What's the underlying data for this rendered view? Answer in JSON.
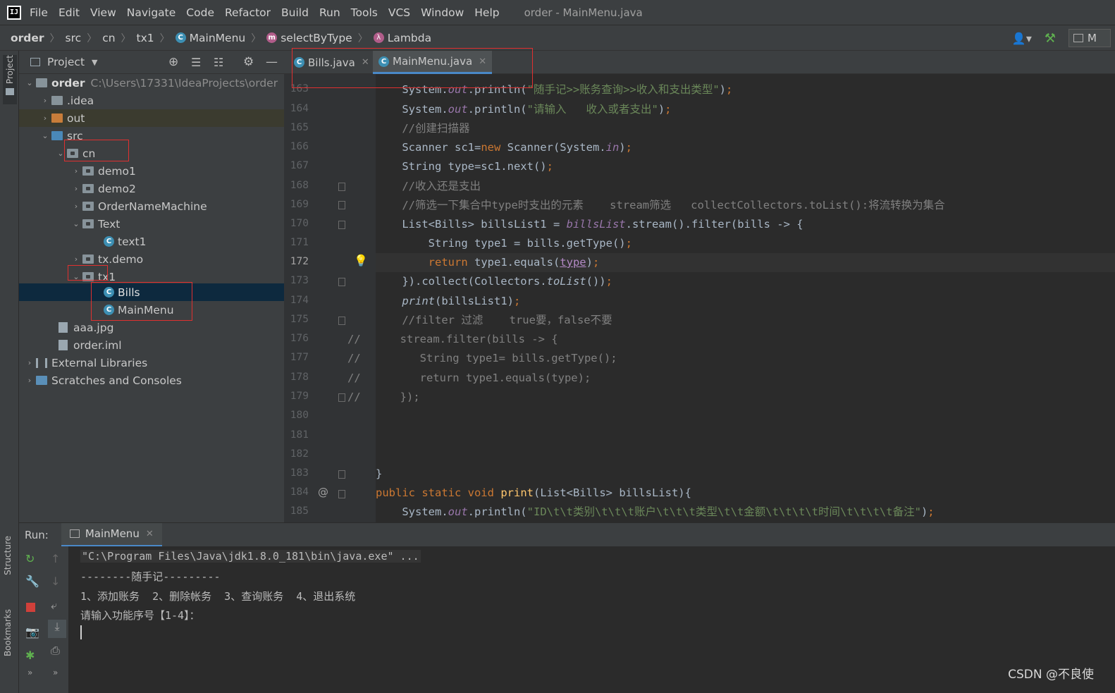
{
  "menubar": {
    "items": [
      "File",
      "Edit",
      "View",
      "Navigate",
      "Code",
      "Refactor",
      "Build",
      "Run",
      "Tools",
      "VCS",
      "Window",
      "Help"
    ],
    "window_title": "order - MainMenu.java"
  },
  "breadcrumb": {
    "items": [
      "order",
      "src",
      "cn",
      "tx1",
      "MainMenu",
      "selectByType",
      "Lambda"
    ],
    "run_config": "M"
  },
  "left_strip": {
    "project": "Project",
    "structure": "Structure",
    "bookmarks": "Bookmarks"
  },
  "project_panel": {
    "title": "Project",
    "root_name": "order",
    "root_path": "C:\\Users\\17331\\IdeaProjects\\order",
    "nodes": [
      ".idea",
      "out",
      "src",
      "cn",
      "demo1",
      "demo2",
      "OrderNameMachine",
      "Text",
      "text1",
      "tx.demo",
      "tx1",
      "Bills",
      "MainMenu",
      "aaa.jpg",
      "order.iml",
      "External Libraries",
      "Scratches and Consoles"
    ]
  },
  "editor": {
    "tabs": [
      "Bills.java",
      "MainMenu.java"
    ],
    "line_numbers": [
      "163",
      "164",
      "165",
      "166",
      "167",
      "168",
      "169",
      "170",
      "171",
      "172",
      "173",
      "174",
      "175",
      "176",
      "177",
      "178",
      "179",
      "180",
      "181",
      "182",
      "183",
      "184",
      "185"
    ],
    "current_line": "172",
    "strings": {
      "s163": "\"随手记>>账务查询>>收入和支出类型\"",
      "s164": "\"请输入   收入或者支出\"",
      "c165": "//创建扫描器",
      "c168": "//收入还是支出",
      "c169": "//筛选一下集合中type时支出的元素    stream筛选   collectCollectors.toList():将流转换为集合",
      "c175": "//filter 过滤    true要，false不要",
      "s185": "\"ID\\t\\t类别\\t\\t\\t账户\\t\\t\\t类型\\t\\t金额\\t\\t\\t\\t时间\\t\\t\\t\\t备注\""
    }
  },
  "run_panel": {
    "label": "Run:",
    "tab": "MainMenu",
    "console_lines": [
      "\"C:\\Program Files\\Java\\jdk1.8.0_181\\bin\\java.exe\" ...",
      "--------随手记---------",
      "1、添加账务  2、删除帐务  3、查询账务  4、退出系统",
      "请输入功能序号【1-4】："
    ]
  },
  "watermark": "CSDN @不良使",
  "colors": {
    "annotation_box": "#e03030",
    "selection": "#0d293e",
    "accent": "#4a88c7"
  }
}
